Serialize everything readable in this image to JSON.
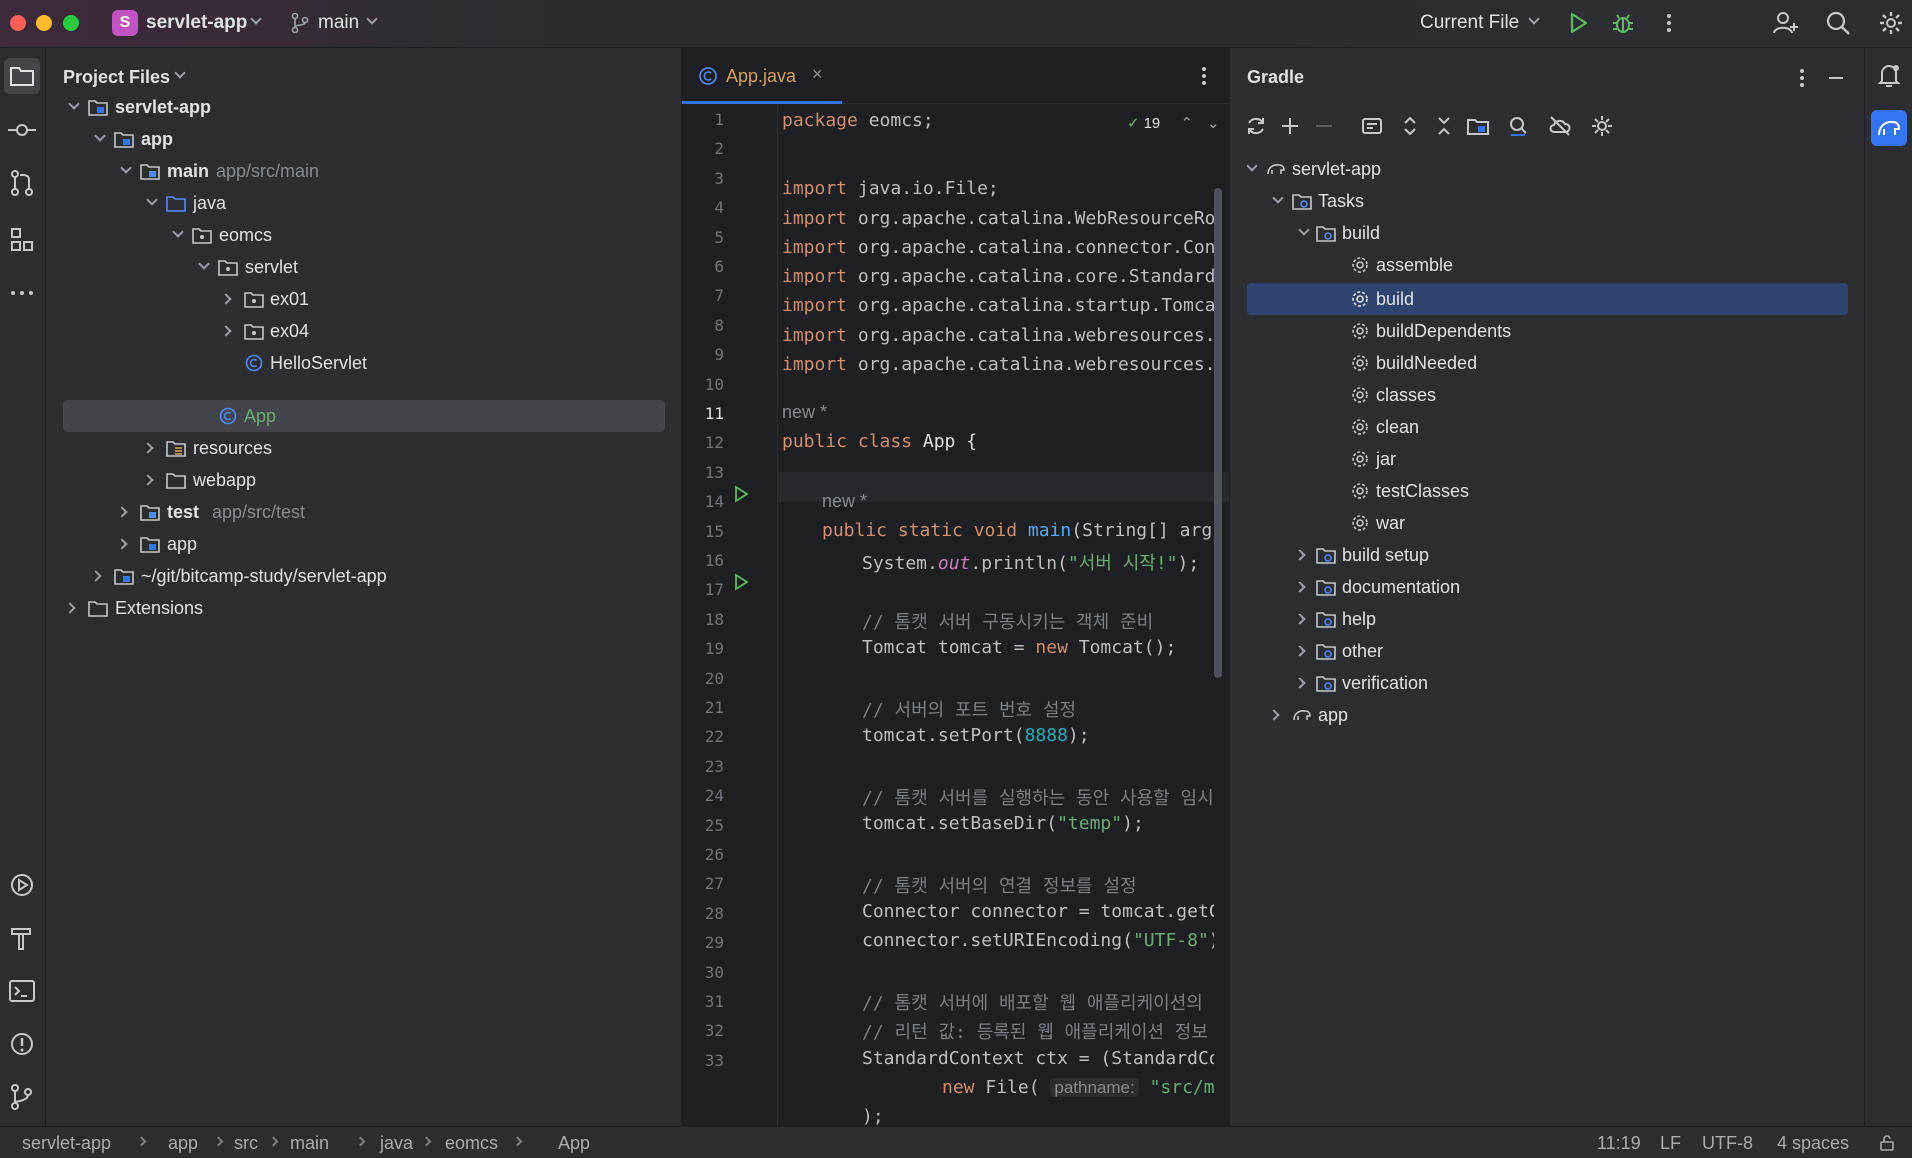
{
  "titlebar": {
    "project_badge": "S",
    "project_name": "servlet-app",
    "branch": "main",
    "run_config": "Current File"
  },
  "project_panel": {
    "title": "Project Files",
    "tree": [
      {
        "label": "servlet-app",
        "bold": true
      },
      {
        "label": "app",
        "bold": true
      },
      {
        "label": "main",
        "hint": "app/src/main",
        "bold": true
      },
      {
        "label": "java"
      },
      {
        "label": "eomcs"
      },
      {
        "label": "servlet"
      },
      {
        "label": "ex01"
      },
      {
        "label": "ex04"
      },
      {
        "label": "HelloServlet"
      },
      {
        "label": "App",
        "selected": true
      },
      {
        "label": "resources"
      },
      {
        "label": "webapp"
      },
      {
        "label": "test",
        "hint": "app/src/test",
        "bold": true
      },
      {
        "label": "app"
      },
      {
        "label": "~/git/bitcamp-study/servlet-app"
      },
      {
        "label": "Extensions"
      }
    ]
  },
  "editor": {
    "tab_label": "App.java",
    "inspection_count": "19",
    "hint_new": "new *",
    "param_hint": "pathname:",
    "line_numbers": [
      "1",
      "2",
      "3",
      "4",
      "5",
      "6",
      "7",
      "8",
      "9",
      "10",
      "11",
      "12",
      "13",
      "14",
      "15",
      "16",
      "17",
      "18",
      "19",
      "20",
      "21",
      "22",
      "23",
      "24",
      "25",
      "26",
      "27",
      "28",
      "29",
      "30",
      "31",
      "32",
      "33"
    ]
  },
  "gradle_panel": {
    "title": "Gradle",
    "tree": [
      {
        "label": "servlet-app"
      },
      {
        "label": "Tasks"
      },
      {
        "label": "build"
      },
      {
        "label": "assemble"
      },
      {
        "label": "build",
        "selected": true
      },
      {
        "label": "buildDependents"
      },
      {
        "label": "buildNeeded"
      },
      {
        "label": "classes"
      },
      {
        "label": "clean"
      },
      {
        "label": "jar"
      },
      {
        "label": "testClasses"
      },
      {
        "label": "war"
      },
      {
        "label": "build setup"
      },
      {
        "label": "documentation"
      },
      {
        "label": "help"
      },
      {
        "label": "other"
      },
      {
        "label": "verification"
      },
      {
        "label": "app"
      }
    ]
  },
  "statusbar": {
    "breadcrumbs": [
      "servlet-app",
      "app",
      "src",
      "main",
      "java",
      "eomcs",
      "App"
    ],
    "position": "11:19",
    "line_ending": "LF",
    "encoding": "UTF-8",
    "indent": "4 spaces"
  },
  "colors": {
    "accent": "#3574f0",
    "selection_gradle": "#2e436e",
    "keyword": "#cf8e6d",
    "string": "#6aab73"
  }
}
